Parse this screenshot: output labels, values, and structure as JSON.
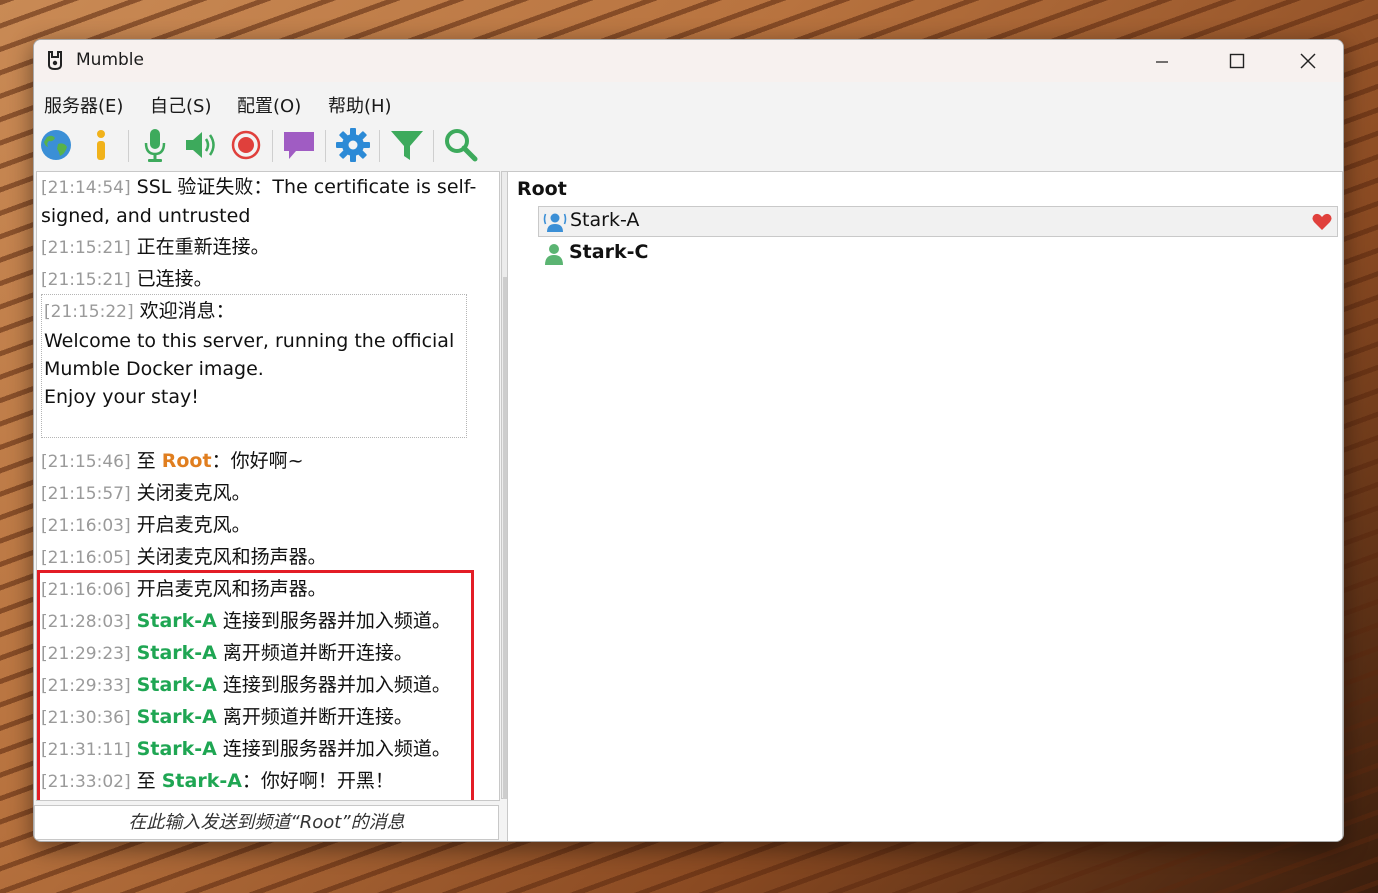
{
  "window": {
    "title": "Mumble"
  },
  "menu": [
    "服务器(E)",
    "自己(S)",
    "配置(O)",
    "帮助(H)"
  ],
  "toolbar_icons": [
    "globe-icon",
    "info-icon",
    "microphone-icon",
    "speaker-icon",
    "record-icon",
    "chat-icon",
    "settings-gear-icon",
    "filter-icon",
    "search-icon"
  ],
  "log": {
    "line1": {
      "time": "[21:14:54]",
      "text": "SSL 验证失败：The certificate is self-"
    },
    "line1b": {
      "text": "signed, and untrusted"
    },
    "line2": {
      "time": "[21:15:21]",
      "text": "正在重新连接。"
    },
    "line3": {
      "time": "[21:15:21]",
      "text": "已连接。"
    },
    "welcome": {
      "time": "[21:15:22]",
      "heading": "欢迎消息：",
      "l1": "Welcome to this server, running the official",
      "l2": "Mumble Docker image.",
      "l3": "Enjoy your stay!"
    },
    "h1": {
      "time": "[21:15:46]",
      "pre": "至",
      "name": "Root",
      "text": "：你好啊~"
    },
    "h2": {
      "time": "[21:15:57]",
      "text": "关闭麦克风。"
    },
    "h3": {
      "time": "[21:16:03]",
      "text": "开启麦克风。"
    },
    "h4": {
      "time": "[21:16:05]",
      "text": "关闭麦克风和扬声器。"
    },
    "h5": {
      "time": "[21:16:06]",
      "text": "开启麦克风和扬声器。"
    },
    "h6": {
      "time": "[21:28:03]",
      "name": "Stark-A",
      "text": " 连接到服务器并加入频道。"
    },
    "h7": {
      "time": "[21:29:23]",
      "name": "Stark-A",
      "text": " 离开频道并断开连接。"
    },
    "h8": {
      "time": "[21:29:33]",
      "name": "Stark-A",
      "text": " 连接到服务器并加入频道。"
    },
    "h9": {
      "time": "[21:30:36]",
      "name": "Stark-A",
      "text": " 离开频道并断开连接。"
    },
    "h10": {
      "time": "[21:31:11]",
      "name": "Stark-A",
      "text": " 连接到服务器并加入频道。"
    },
    "h11": {
      "time": "[21:33:02]",
      "pre": "至",
      "name": "Stark-A",
      "text": "：你好啊！开黑！"
    }
  },
  "chat_input": {
    "placeholder": "在此输入发送到频道“Root”的消息"
  },
  "tree": {
    "root": "Root",
    "users": [
      {
        "name": "Stark-A",
        "selected": true,
        "icon": "user-talking-icon",
        "status_icon": "heart-icon"
      },
      {
        "name": "Stark-C",
        "selected": false,
        "bold": true,
        "icon": "user-icon"
      }
    ]
  },
  "colors": {
    "highlight_border": "#e31d26",
    "name_green": "#1fa653",
    "name_orange": "#e07e1f"
  }
}
